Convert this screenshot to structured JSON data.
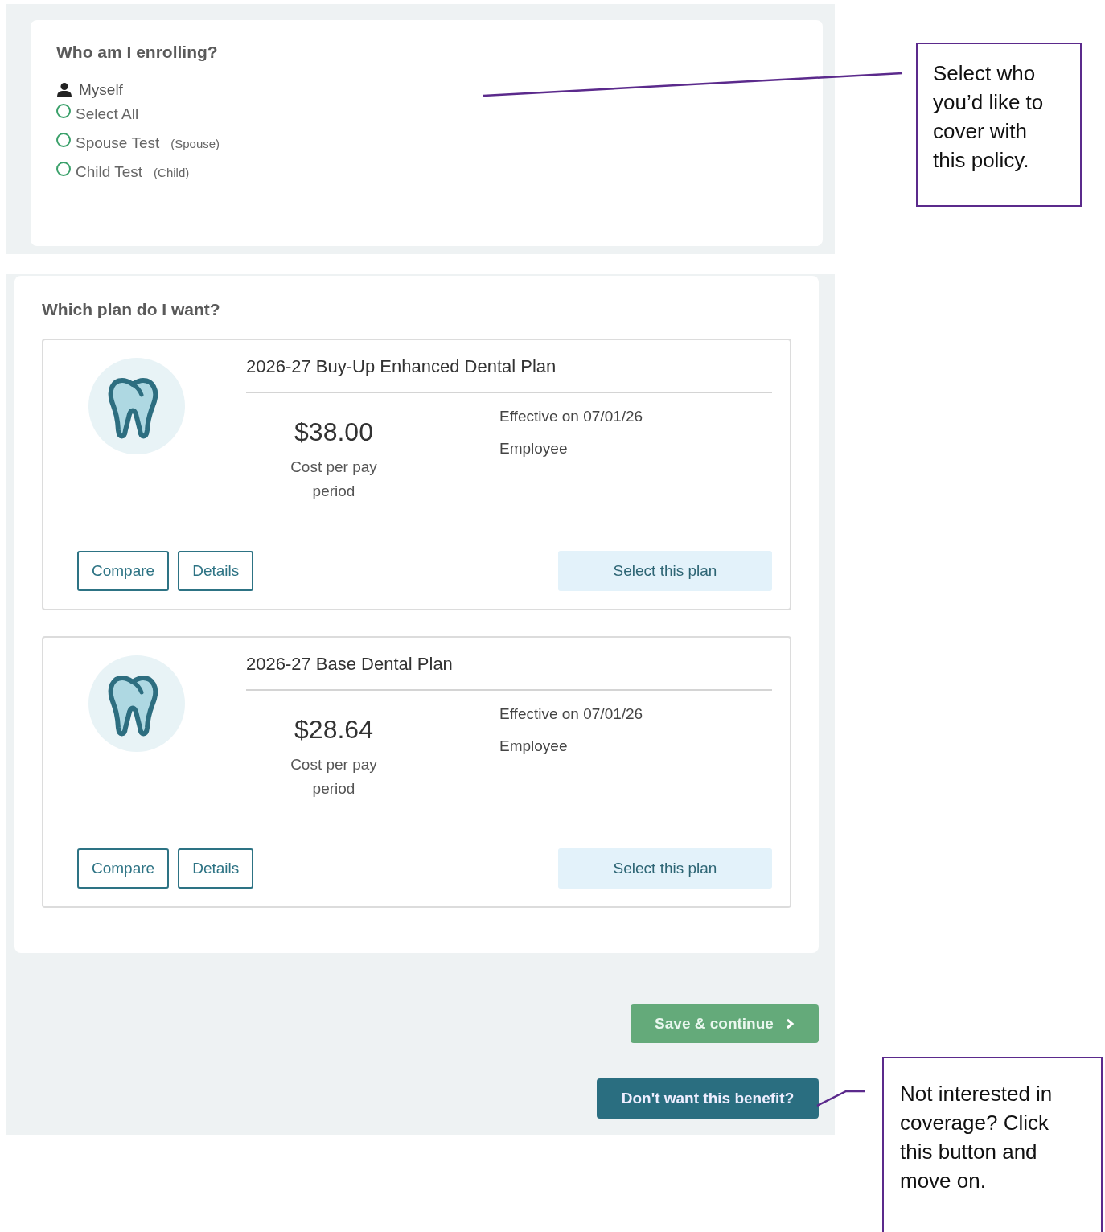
{
  "enrollment": {
    "title": "Who am I enrolling?",
    "self": "Myself",
    "members": [
      {
        "name": "Select All",
        "checked": false
      },
      {
        "name": "Spouse Test",
        "relation": "(Spouse)",
        "checked": false
      },
      {
        "name": "Child Test",
        "relation": "(Child)",
        "checked": false
      }
    ]
  },
  "plans": {
    "title": "Which plan do I want?",
    "items": [
      {
        "name": "2026-27 Buy-Up Enhanced Dental Plan",
        "price": "$38.00",
        "price_label": "Cost per pay period",
        "effective": "Effective on 07/01/26",
        "coverage": "Employee",
        "buttons": [
          "Compare",
          "Details"
        ],
        "select": "Select this plan"
      },
      {
        "name": "2026-27 Base Dental Plan",
        "price": "$28.64",
        "price_label": "Cost per pay period",
        "effective": "Effective on 07/01/26",
        "coverage": "Employee",
        "buttons": [
          "Compare",
          "Details"
        ],
        "select": "Select this plan"
      }
    ]
  },
  "actions": {
    "save": "Save & continue",
    "decline": "Don't want this benefit?"
  },
  "callouts": [
    {
      "text": "Select who you’d like to cover with this policy."
    },
    {
      "text": "Not interested in coverage? Click this button and move on."
    }
  ]
}
